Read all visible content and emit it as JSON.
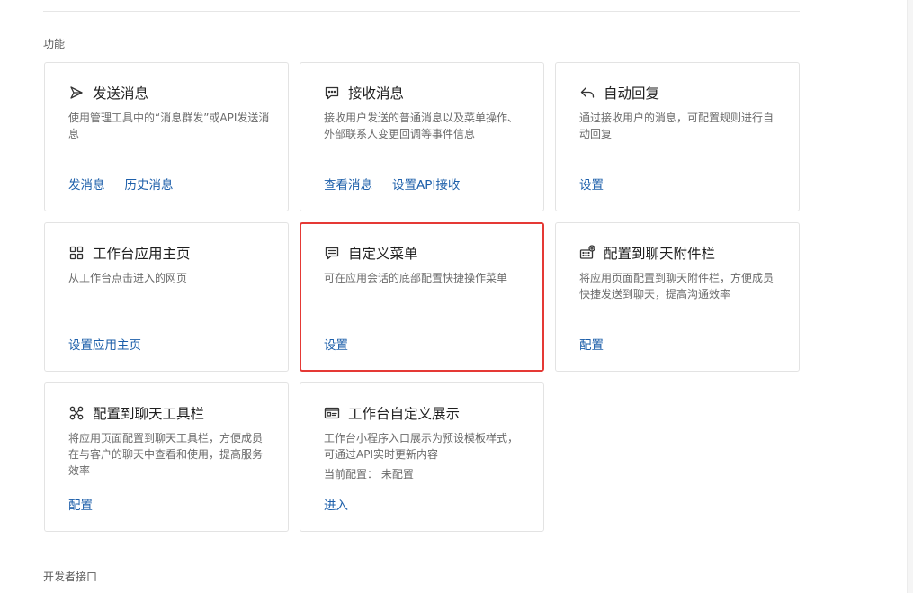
{
  "sections": {
    "features_title": "功能",
    "developer_title": "开发者接口"
  },
  "cards": [
    {
      "title": "发送消息",
      "icon": "send-icon",
      "desc": "使用管理工具中的“消息群发”或API发送消息",
      "actions": [
        "发消息",
        "历史消息"
      ]
    },
    {
      "title": "接收消息",
      "icon": "chat-bubble-icon",
      "desc": "接收用户发送的普通消息以及菜单操作、外部联系人变更回调等事件信息",
      "actions": [
        "查看消息",
        "设置API接收"
      ]
    },
    {
      "title": "自动回复",
      "icon": "reply-icon",
      "desc": "通过接收用户的消息，可配置规则进行自动回复",
      "actions": [
        "设置"
      ]
    },
    {
      "title": "工作台应用主页",
      "icon": "grid-icon",
      "desc": "从工作台点击进入的网页",
      "actions": [
        "设置应用主页"
      ]
    },
    {
      "title": "自定义菜单",
      "icon": "menu-icon",
      "desc": "可在应用会话的底部配置快捷操作菜单",
      "actions": [
        "设置"
      ],
      "selected": true
    },
    {
      "title": "配置到聊天附件栏",
      "icon": "keyboard-plus-icon",
      "desc": "将应用页面配置到聊天附件栏，方便成员快捷发送到聊天，提高沟通效率",
      "actions": [
        "配置"
      ]
    },
    {
      "title": "配置到聊天工具栏",
      "icon": "toolbar-icon",
      "desc": "将应用页面配置到聊天工具栏，方便成员在与客户的聊天中查看和使用，提高服务效率",
      "actions": [
        "配置"
      ]
    },
    {
      "title": "工作台自定义展示",
      "icon": "card-display-icon",
      "desc": "工作台小程序入口展示为预设模板样式，可通过API实时更新内容",
      "extra": "当前配置： 未配置",
      "actions": [
        "进入"
      ]
    }
  ],
  "colors": {
    "link": "#1d5faa",
    "highlight_border": "#e53935"
  }
}
